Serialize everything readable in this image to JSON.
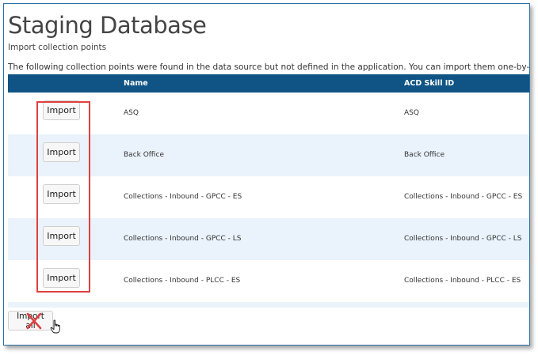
{
  "page": {
    "title": "Staging Database",
    "subtitle": "Import collection points",
    "description": "The following collection points were found in the data source but not defined in the application. You can import them one-by-one below."
  },
  "table": {
    "headers": {
      "name": "Name",
      "skill": "ACD Skill ID"
    },
    "rows": [
      {
        "name": "ASQ",
        "skill": "ASQ",
        "button": "Import"
      },
      {
        "name": "Back Office",
        "skill": "Back Office",
        "button": "Import"
      },
      {
        "name": "Collections - Inbound - GPCC - ES",
        "skill": "Collections - Inbound - GPCC - ES",
        "button": "Import"
      },
      {
        "name": "Collections - Inbound - GPCC - LS",
        "skill": "Collections - Inbound - GPCC - LS",
        "button": "Import"
      },
      {
        "name": "Collections - Inbound - PLCC - ES",
        "skill": "Collections - Inbound - PLCC - ES",
        "button": "Import"
      }
    ]
  },
  "footer": {
    "import_all_label": "Import all"
  },
  "colors": {
    "header_bg": "#0f5484",
    "row_alt": "#eaf3fb",
    "highlight": "#e04040"
  },
  "icons": {
    "cross": "x-mark-icon",
    "pointer": "hand-cursor-icon"
  }
}
